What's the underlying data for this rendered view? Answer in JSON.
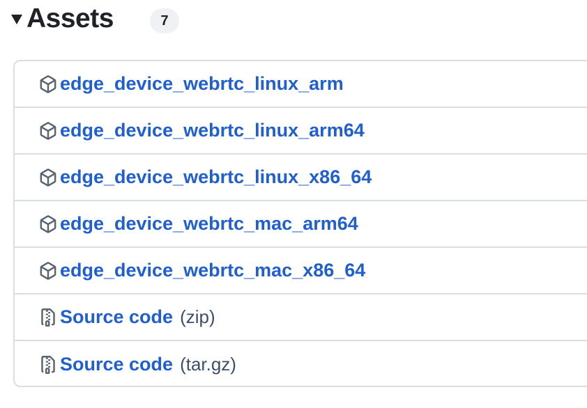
{
  "assets": {
    "title": "Assets",
    "count": "7",
    "items": [
      {
        "label": "edge_device_webrtc_linux_arm",
        "suffix": "",
        "icon": "package-icon"
      },
      {
        "label": "edge_device_webrtc_linux_arm64",
        "suffix": "",
        "icon": "package-icon"
      },
      {
        "label": "edge_device_webrtc_linux_x86_64",
        "suffix": "",
        "icon": "package-icon"
      },
      {
        "label": "edge_device_webrtc_mac_arm64",
        "suffix": "",
        "icon": "package-icon"
      },
      {
        "label": "edge_device_webrtc_mac_x86_64",
        "suffix": "",
        "icon": "package-icon"
      },
      {
        "label": "Source code",
        "suffix": "(zip)",
        "icon": "file-zip-icon"
      },
      {
        "label": "Source code",
        "suffix": "(tar.gz)",
        "icon": "file-zip-icon"
      }
    ]
  },
  "colors": {
    "link": "#1f5fcf",
    "border": "#d8dee4",
    "badge_bg": "#eff1f3",
    "text": "#1f2328"
  }
}
